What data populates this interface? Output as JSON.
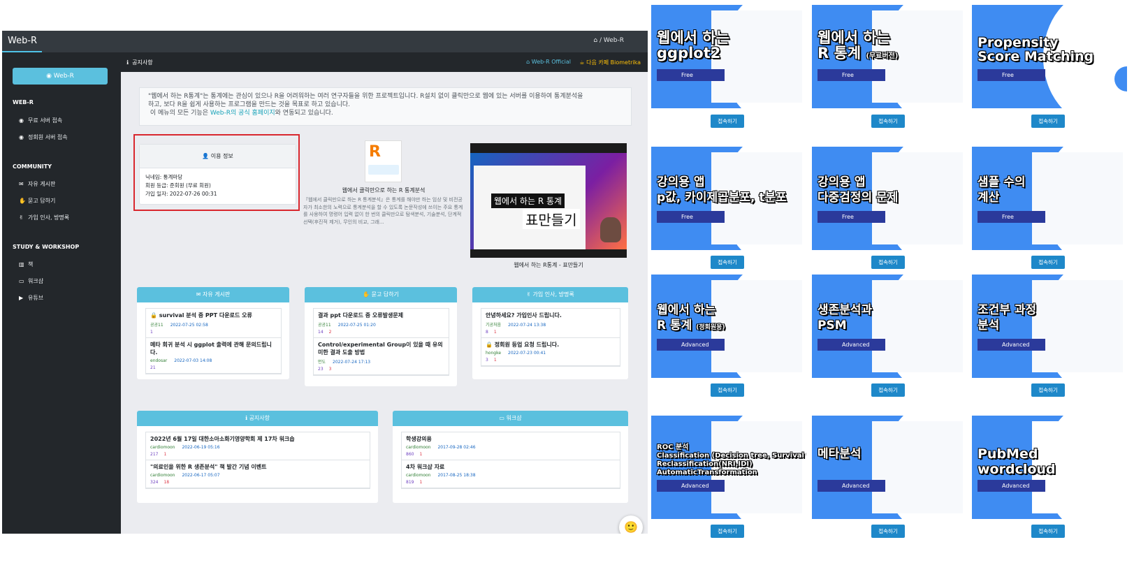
{
  "topbar": {
    "brand": "Web-R",
    "breadcrumb": "Web-R"
  },
  "sidebar": {
    "button": "Web-R",
    "sections": [
      {
        "title": "WEB-R",
        "items": [
          {
            "label": "무료 서버 접속",
            "icon": "eye-icon"
          },
          {
            "label": "정회원 서버 접속",
            "icon": "eye-icon"
          }
        ]
      },
      {
        "title": "COMMUNITY",
        "items": [
          {
            "label": "자유 게시판",
            "icon": "comments-icon"
          },
          {
            "label": "묻고 답하기",
            "icon": "hands-icon"
          },
          {
            "label": "가입 인사, 방명록",
            "icon": "hand-icon"
          }
        ]
      },
      {
        "title": "STUDY & WORKSHOP",
        "items": [
          {
            "label": "책",
            "icon": "books-icon"
          },
          {
            "label": "워크샵",
            "icon": "chalkboard-icon"
          },
          {
            "label": "유튜브",
            "icon": "youtube-icon"
          }
        ]
      }
    ]
  },
  "tabbar": {
    "tab": "공지사항",
    "official": "Web-R Official",
    "cafe": "다음 카페 Biometrika"
  },
  "notice": {
    "line1": "\"웹에서 하는 R통계\"는 통계에는 관심이 있으나 R을 어려워하는 여러 연구자들을 위한 프로젝트입니다. R설치 없이 클릭만으로 웹에 있는 서버를 이용하여 통계분석을",
    "line2": "하고, 보다 R을 쉽게 사용하는 프로그램을 만드는 것을 목표로 하고 있습니다.",
    "line3_pre": "이 메뉴의 모든 기능은 ",
    "line3_link": "Web-R의 공식 홈페이지",
    "line3_post": "와 연동되고 있습니다."
  },
  "userinfo": {
    "title": "이용 정보",
    "nickname": "닉네임: 통계마당",
    "grade": "회원 등급: 준회원 (무료 회원)",
    "joined": "가입 일자: 2022-07-26 00:31"
  },
  "book": {
    "title": "웹에서 클릭만으로 하는 R 통계분석",
    "desc": "『웹에서 클릭만으로 하는 R 통계분석』은 통계를 해야만 하는 임상 및 비전공자가 최소한의 노력으로 통계분석을 할 수 있도록 논문작성에 쓰이는 주요 통계를 사용하여 명령어 입력 없이 한 번의 클릭만으로 탐색분석, 기술분석, 단계적 선택(후진적 제거), 무인의 비교, 그래..."
  },
  "video": {
    "caption1": "웹에서 하는 R 통계",
    "caption2": "표만들기",
    "title": "웹에서 하는 R통계 - 표만들기"
  },
  "boards": [
    {
      "title": "자유 게시판",
      "icon": "comments-icon",
      "posts": [
        {
          "title": "survival 분석 중 PPT 다운로드 오류",
          "locked": true,
          "author": "공공11",
          "date": "2022-07-25 02:58",
          "views": "1",
          "comments": ""
        },
        {
          "title": "메타 회귀 분석 시 ggplot 출력에 관해 문의드립니다.",
          "locked": false,
          "author": "endosar",
          "date": "2022-07-03 14:08",
          "views": "21",
          "comments": ""
        }
      ]
    },
    {
      "title": "묻고 답하기",
      "icon": "hands-icon",
      "posts": [
        {
          "title": "결과 ppt 다운로드 중 오류발생문제",
          "locked": false,
          "author": "공공11",
          "date": "2022-07-25 01:20",
          "views": "14",
          "comments": "2"
        },
        {
          "title": "Control/experimental Group이 있을 때 유의미한 결과 도출 방법",
          "locked": false,
          "author": "먼도",
          "date": "2022-07-24 17:13",
          "views": "23",
          "comments": "3"
        }
      ]
    },
    {
      "title": "가입 인사, 방명록",
      "icon": "hand-icon",
      "posts": [
        {
          "title": "안녕하세요? 가입인사 드립니다.",
          "locked": false,
          "author": "기공처음",
          "date": "2022-07-24 13:38",
          "views": "8",
          "comments": "1"
        },
        {
          "title": "정회원 등업 요청 드립니다.",
          "locked": true,
          "author": "hongke",
          "date": "2022-07-23 00:41",
          "views": "3",
          "comments": "1"
        }
      ]
    },
    {
      "title": "공지사항",
      "icon": "info-icon",
      "posts": [
        {
          "title": "2022년 6월 17일 대한소아소화기영양학회 제 17차 워크숍",
          "locked": false,
          "author": "cardiomoon",
          "date": "2022-06-19 05:16",
          "views": "217",
          "comments": "1"
        },
        {
          "title": "\"의료인을 위한 R 생존분석\" 책 발간 기념 이벤트",
          "locked": false,
          "author": "cardiomoon",
          "date": "2022-06-17 05:07",
          "views": "324",
          "comments": "18"
        }
      ]
    },
    {
      "title": "워크샵",
      "icon": "chalkboard-icon",
      "posts": [
        {
          "title": "학생강의용",
          "locked": false,
          "author": "cardiomoon",
          "date": "2017-09-28 02:46",
          "views": "860",
          "comments": "1"
        },
        {
          "title": "4차 워크샵 자료",
          "locked": false,
          "author": "cardiomoon",
          "date": "2017-08-25 18:38",
          "views": "819",
          "comments": "1"
        }
      ]
    }
  ],
  "apps": [
    {
      "line1": "웹에서 하는",
      "line2": "ggplot2",
      "sub": "",
      "badge": "Free"
    },
    {
      "line1": "웹에서 하는",
      "line2": "R 통계",
      "sub": "(무료버전)",
      "badge": "Free"
    },
    {
      "line1": "Propensity",
      "line2": "Score Matching",
      "sub": "",
      "badge": "Free"
    },
    {
      "line1": "강의용 앱",
      "line2": "p값, 카이제곱분포, t분포",
      "sub": "",
      "badge": "Free"
    },
    {
      "line1": "강의용 앱",
      "line2": "다중검정의 문제",
      "sub": "",
      "badge": "Free"
    },
    {
      "line1": "샘플 수의",
      "line2": "계산",
      "sub": "",
      "badge": "Free"
    },
    {
      "line1": "웹에서 하는",
      "line2": "R 통계",
      "sub": "(정회원용)",
      "badge": "Advanced"
    },
    {
      "line1": "생존분석과",
      "line2": "PSM",
      "sub": "",
      "badge": "Advanced"
    },
    {
      "line1": "조건부 과정",
      "line2": "분석",
      "sub": "",
      "badge": "Advanced"
    },
    {
      "line1": "ROC 분석",
      "line2": "Classification (Decision tree, Survival tree)",
      "line3": "Reclassification(NRI,IDI)",
      "line4": "AutomaticTransformation",
      "sub": "",
      "badge": "Advanced"
    },
    {
      "line1": "",
      "line2": "메타분석",
      "sub": "",
      "badge": "Advanced"
    },
    {
      "line1": "PubMed",
      "line2": "wordcloud",
      "sub": "",
      "badge": "Advanced"
    }
  ],
  "connect_label": "접속하기"
}
